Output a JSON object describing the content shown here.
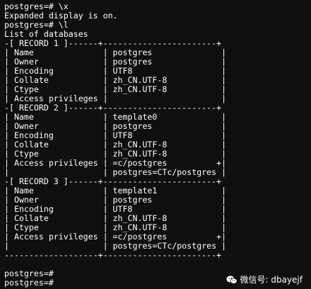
{
  "terminal": {
    "lines": [
      "postgres=# \\x",
      "Expanded display is on.",
      "postgres=# \\l",
      "List of databases",
      "-[ RECORD 1 ]------+-----------------------+",
      "| Name              | postgres              |",
      "| Owner             | postgres              |",
      "| Encoding          | UTF8                  |",
      "| Collate           | zh_CN.UTF-8           |",
      "| Ctype             | zh_CN.UTF-8           |",
      "| Access privileges |                       |",
      "-[ RECORD 2 ]------+-----------------------+",
      "| Name              | template0             |",
      "| Owner             | postgres              |",
      "| Encoding          | UTF8                  |",
      "| Collate           | zh_CN.UTF-8           |",
      "| Ctype             | zh_CN.UTF-8           |",
      "| Access privileges | =c/postgres          +|",
      "|                   | postgres=CTc/postgres |",
      "-[ RECORD 3 ]------+-----------------------+",
      "| Name              | template1             |",
      "| Owner             | postgres              |",
      "| Encoding          | UTF8                  |",
      "| Collate           | zh_CN.UTF-8           |",
      "| Ctype             | zh_CN.UTF-8           |",
      "| Access privileges | =c/postgres          +|",
      "|                   | postgres=CTc/postgres |",
      "-------------------+-----------------------+",
      "",
      "postgres=#",
      "postgres=#"
    ]
  },
  "watermark": {
    "icon": "wechat-icon",
    "text": "微信号: dbayejf"
  }
}
